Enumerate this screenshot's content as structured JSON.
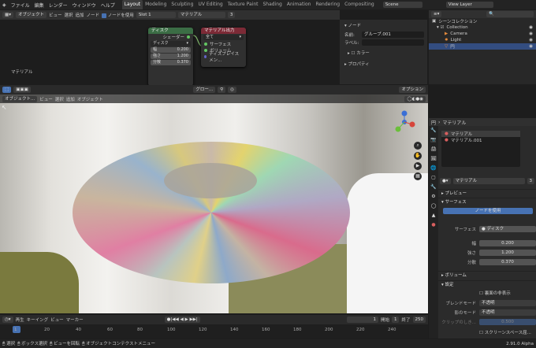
{
  "menu": [
    "ファイル",
    "編集",
    "レンダー",
    "ウィンドウ",
    "ヘルプ"
  ],
  "workspaces": [
    "Layout",
    "Modeling",
    "Sculpting",
    "UV Editing",
    "Texture Paint",
    "Shading",
    "Animation",
    "Rendering",
    "Compositing"
  ],
  "scene": "Scene",
  "view_layer": "View Layer",
  "node_header": {
    "mode": "オブジェクト",
    "view": "ビュー",
    "select": "選択",
    "add": "追加",
    "node": "ノード",
    "use_nodes": "ノードを使用",
    "slot": "Slot 1",
    "material": "マテリアル",
    "users": "3"
  },
  "node_disk": {
    "title": "ディスク",
    "output": "シェーダー",
    "type": "ディスク",
    "scale_label": "幅",
    "scale": "0.200",
    "strength_label": "強さ",
    "strength": "1.200",
    "div_label": "分散",
    "div": "0.370"
  },
  "node_output": {
    "title": "マテリアル出力",
    "target": "全て",
    "surface": "サーフェス",
    "volume": "ボリューム",
    "displacement": "ディスプレイスメン..."
  },
  "node_editor_label": "マテリアル",
  "n_panel": {
    "section": "ノード",
    "name_label": "名前:",
    "name": "グループ.001",
    "label_label": "ラベル:",
    "color": "カラー",
    "properties": "プロパティ"
  },
  "outliner": {
    "title": "シーンコレクション",
    "collection": "Collection",
    "camera": "Camera",
    "light": "Light",
    "obj": "円"
  },
  "viewport": {
    "mode": "オブジェクト...",
    "view": "ビュー",
    "select": "選択",
    "add": "追加",
    "object": "オブジェクト",
    "orient": "グロー...",
    "options": "オプション"
  },
  "props": {
    "obj": "円",
    "mat_tab": "マテリアル",
    "slots": [
      "マテリアル",
      "マテリアル.001"
    ],
    "mat_name": "マテリアル",
    "users": "3",
    "preview": "プレビュー",
    "surface": "サーフェス",
    "use_nodes": "ノードを使用",
    "surface_label": "サーフェス",
    "surface_val": "ディスク",
    "scale_label": "幅",
    "scale": "0.200",
    "strength_label": "強さ",
    "strength": "1.200",
    "div_label": "分散",
    "div": "0.370",
    "volume": "ボリューム",
    "settings": "設定",
    "backface": "裏面の非表示",
    "blend_label": "ブレンドモード",
    "blend": "不透明",
    "shadow_label": "影のモード",
    "shadow": "不透明",
    "clip_label": "クリップのしき...",
    "clip": "0.500",
    "screen_space": "スクリーンスペース屈..."
  },
  "timeline": {
    "play": "再生",
    "keying": "キーイング",
    "view": "ビュー",
    "marker": "マーカー",
    "current": "1",
    "start_label": "開始",
    "start": "1",
    "end_label": "終了",
    "end": "250",
    "ticks": [
      "1",
      "20",
      "40",
      "60",
      "80",
      "100",
      "120",
      "140",
      "160",
      "180",
      "200",
      "220",
      "240"
    ]
  },
  "status": {
    "select": "選択",
    "box": "ボックス選択",
    "rotate": "ビューを回転",
    "ctx": "オブジェクトコンテクストメニュー",
    "version": "2.91.0 Alpha"
  }
}
